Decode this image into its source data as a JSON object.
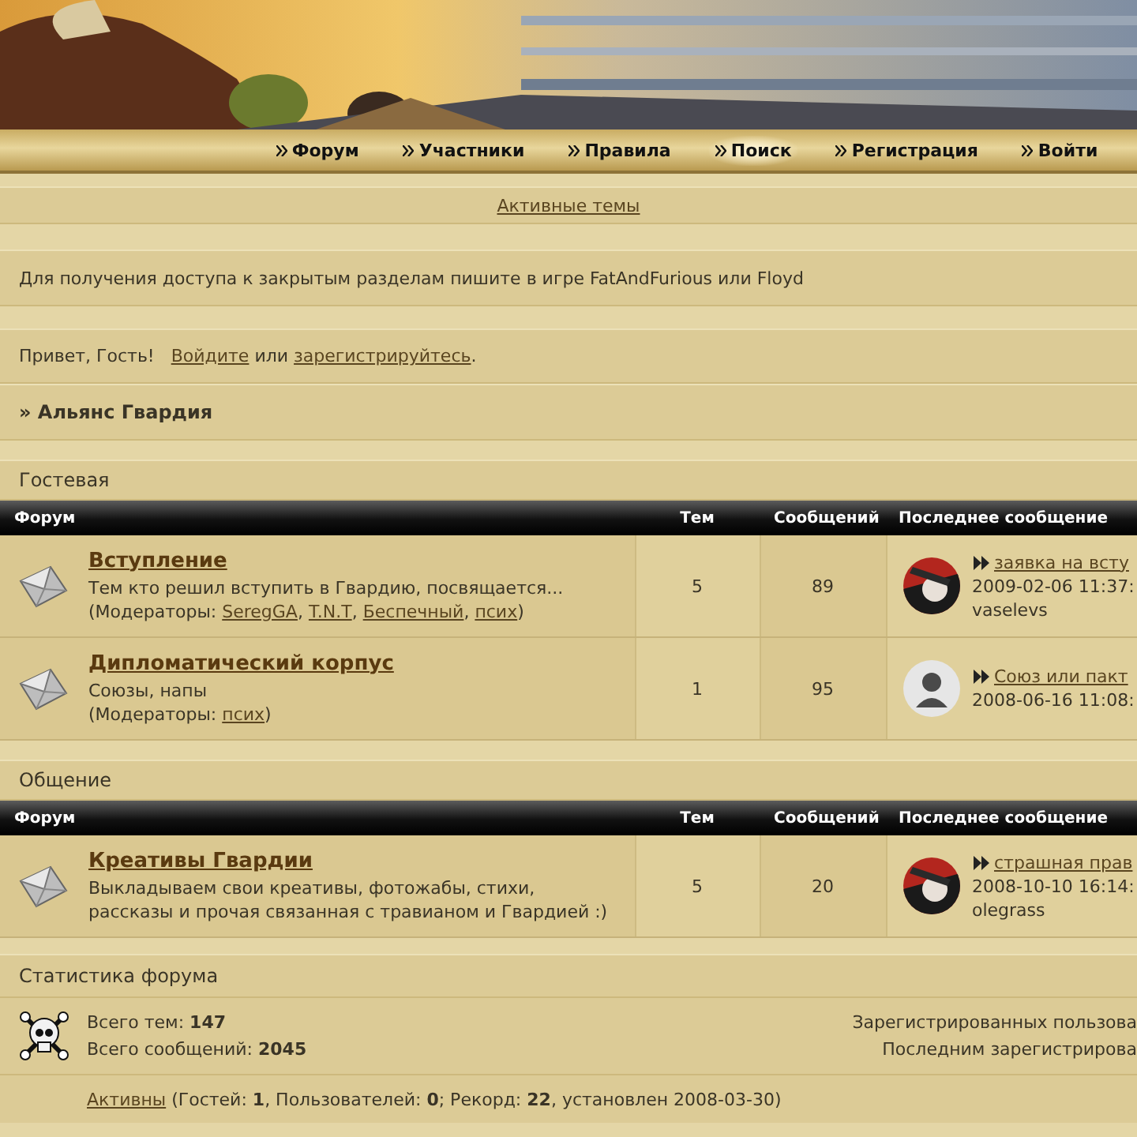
{
  "nav": [
    {
      "label": "Форум",
      "selected": false
    },
    {
      "label": "Участники",
      "selected": false
    },
    {
      "label": "Правила",
      "selected": false
    },
    {
      "label": "Поиск",
      "selected": true
    },
    {
      "label": "Регистрация",
      "selected": false
    },
    {
      "label": "Войти",
      "selected": false
    }
  ],
  "active_topics_link": "Активные темы",
  "notice": "Для получения доступа к закрытым разделам пишите в игре FatAndFurious или Floyd",
  "greeting": {
    "text": "Привет, Гость!",
    "login": "Войдите",
    "or": "или",
    "register": "зарегистрируйтесь",
    "end": "."
  },
  "breadcrumb": "» Альянс Гвардия",
  "categories": [
    {
      "title": "Гостевая",
      "columns": [
        "Форум",
        "Тем",
        "Сообщений",
        "Последнее сообщение"
      ],
      "forums": [
        {
          "name": "Вступление",
          "description": "Тем кто решил вступить в Гвардию, посвящается...",
          "moderators_label": "(Модераторы:",
          "moderators": [
            {
              "name": "SeregGA",
              "after": ","
            },
            {
              "name": "T.N.T",
              "after": ","
            },
            {
              "name": "Беспечный",
              "after": ","
            },
            {
              "name": "псих",
              "after": ")"
            }
          ],
          "topics": "5",
          "posts": "89",
          "last_post": {
            "title": "заявка на всту",
            "date": "2009-02-06 11:37:",
            "author": "vaselevs"
          }
        },
        {
          "name": "Дипломатический корпус",
          "description": "Союзы, напы",
          "moderators_label": "(Модераторы:",
          "moderators": [
            {
              "name": "псих",
              "after": ")"
            }
          ],
          "topics": "1",
          "posts": "95",
          "last_post": {
            "avatar": {
              "kind": "silhouette"
            },
            "title": "Союз или пакт",
            "date": "2008-06-16 11:08:"
          }
        }
      ]
    },
    {
      "title": "Общение",
      "columns": [
        "Форум",
        "Тем",
        "Сообщений",
        "Последнее сообщение"
      ],
      "forums": [
        {
          "name": "Креативы Гвардии",
          "description": "Выкладываем свои креативы, фотожабы, стихи, рассказы и прочая связанная с травианом и Гвардией :)",
          "topics": "5",
          "posts": "20",
          "last_post": {
            "title": "страшная прав",
            "date": "2008-10-10 16:14:",
            "author": "olegrass"
          }
        }
      ]
    }
  ],
  "stats": {
    "title": "Статистика форума",
    "topics_label": "Всего тем:",
    "topics": "147",
    "posts_label": "Всего сообщений:",
    "posts": "2045",
    "registered": "Зарегистрированных пользова",
    "last_registered": "Последним зарегистрирова",
    "online_link": "Активны",
    "online_text": "(Гостей: **1**, Пользователей: **0**; Рекорд: **22**, установлен 2008-03-30)"
  }
}
